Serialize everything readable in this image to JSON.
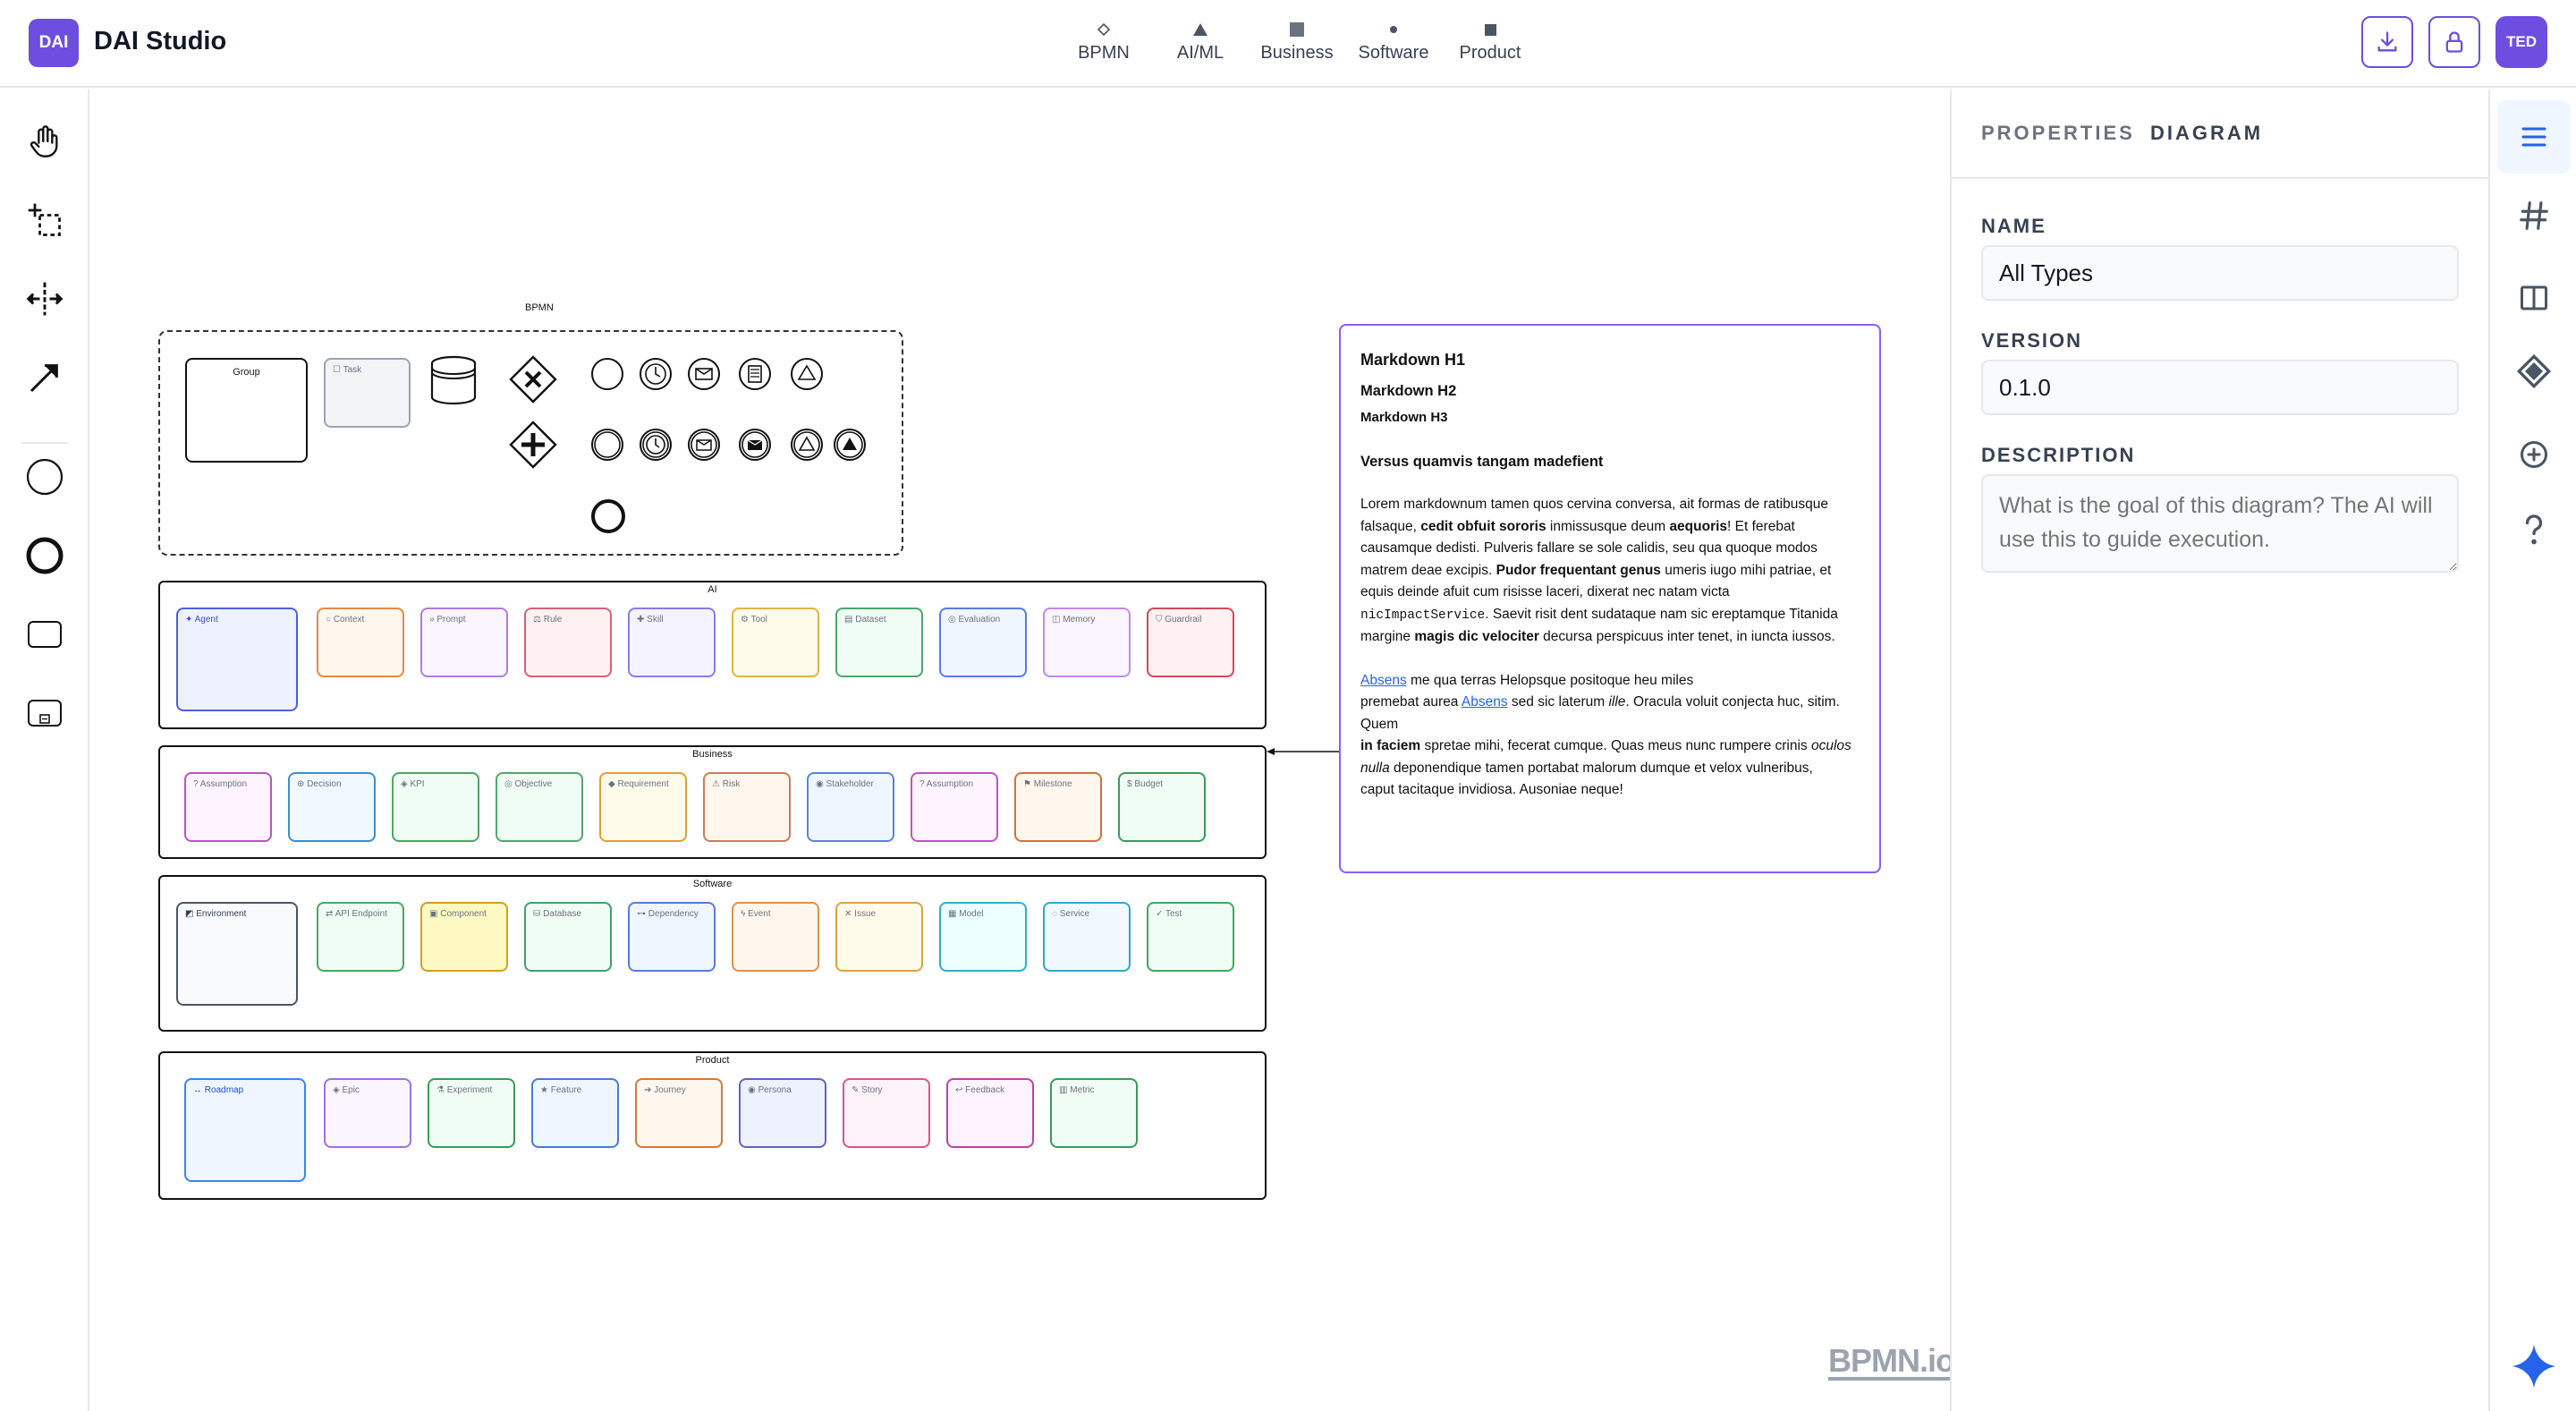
{
  "app": {
    "logo": "DAI",
    "title": "DAI Studio",
    "user_initials": "TED"
  },
  "diagram_tabs": [
    {
      "label": "BPMN",
      "icon": "diamond-outline-icon"
    },
    {
      "label": "AI/ML",
      "icon": "triangle-icon"
    },
    {
      "label": "Business",
      "icon": "square-icon"
    },
    {
      "label": "Software",
      "icon": "dot-icon"
    },
    {
      "label": "Product",
      "icon": "small-square-icon"
    }
  ],
  "header_actions": [
    {
      "icon": "download-icon"
    },
    {
      "icon": "lock-icon"
    }
  ],
  "left_tools": [
    {
      "icon": "hand-tool-icon"
    },
    {
      "icon": "lasso-tool-icon"
    },
    {
      "icon": "space-tool-icon"
    },
    {
      "icon": "connect-arrow-icon"
    },
    {
      "icon": "start-event-icon"
    },
    {
      "icon": "end-event-icon"
    },
    {
      "icon": "task-icon"
    },
    {
      "icon": "subprocess-icon"
    }
  ],
  "lanes": {
    "bpmn": {
      "title": "BPMN",
      "group_label": "Group",
      "task_label": "Task"
    },
    "ai": {
      "title": "AI",
      "nodes": [
        "Agent",
        "Context",
        "Prompt",
        "Rule",
        "Skill",
        "Tool",
        "Dataset",
        "Evaluation",
        "Memory",
        "Guardrail"
      ]
    },
    "business": {
      "title": "Business",
      "nodes": [
        "Assumption",
        "Decision",
        "KPI",
        "Objective",
        "Requirement",
        "Risk",
        "Stakeholder",
        "Assumption",
        "Milestone",
        "Budget"
      ]
    },
    "software": {
      "title": "Software",
      "nodes": [
        "Environment",
        "API Endpoint",
        "Component",
        "Database",
        "Dependency",
        "Event",
        "Issue",
        "Model",
        "Service",
        "Test"
      ]
    },
    "product": {
      "title": "Product",
      "nodes": [
        "Roadmap",
        "Epic",
        "Experiment",
        "Feature",
        "Journey",
        "Persona",
        "Story",
        "Feedback",
        "Metric"
      ]
    }
  },
  "markdown": {
    "h1": "Markdown H1",
    "h2": "Markdown H2",
    "h3": "Markdown H3",
    "h4": "Versus quamvis tangam madefient",
    "p1_a": "Lorem markdownum tamen quos cervina conversa, ait formas de ratibusque falsaque, ",
    "p1_b": "cedit obfuit sororis",
    "p1_c": " inmissusque deum ",
    "p1_d": "aequoris",
    "p1_e": "! Et ferebat causamque dedisti. Pulveris fallare se sole calidis, seu qua quoque modos matrem deae excipis. ",
    "p1_f": "Pudor frequentant genus",
    "p1_g": " umeris iugo mihi patriae, et equis deinde afuit cum risisse laceri, dixerat nec natam victa ",
    "p1_code": "nicImpactService",
    "p1_h": ". Saevit risit dent sudataque nam sic ereptamque Titanida margine ",
    "p1_i": "magis dic velociter",
    "p1_j": " decursa perspicuus inter tenet, in iuncta iussos.",
    "p2_link1": "Absens",
    "p2_a": " me qua terras Helopsque positoque heu miles",
    "p2_b": "premebat aurea ",
    "p2_link2": "Absens",
    "p2_c": " sed sic laterum ",
    "p2_ille": "ille",
    "p2_d": ". Oracula voluit conjecta huc, sitim. Quem",
    "p2_faciem": "in faciem",
    "p2_e": " spretae mihi, fecerat cumque. Quas meus nunc rumpere crinis ",
    "p2_oculos": "oculos nulla",
    "p2_f": " deponendique tamen portabat malorum dumque et velox vulneribus,",
    "p2_g": "caput tacitaque invidiosa. Ausoniae neque!"
  },
  "watermark": "BPMN.io",
  "properties": {
    "header_muted": "PROPERTIES",
    "header_strong": "DIAGRAM",
    "name_label": "NAME",
    "name_value": "All Types",
    "version_label": "VERSION",
    "version_value": "0.1.0",
    "description_label": "DESCRIPTION",
    "description_placeholder": "What is the goal of this diagram? The AI will use this to guide execution."
  },
  "rail": [
    {
      "icon": "menu-icon",
      "active": true
    },
    {
      "icon": "hash-icon"
    },
    {
      "icon": "columns-icon"
    },
    {
      "icon": "diamond-icon"
    },
    {
      "icon": "plus-circle-icon"
    },
    {
      "icon": "help-icon"
    },
    {
      "icon": "sparkle-icon"
    }
  ],
  "colors": {
    "brand": "#6d4ee0",
    "rail_active": "#2563eb",
    "md_border": "#8b5cf6"
  }
}
